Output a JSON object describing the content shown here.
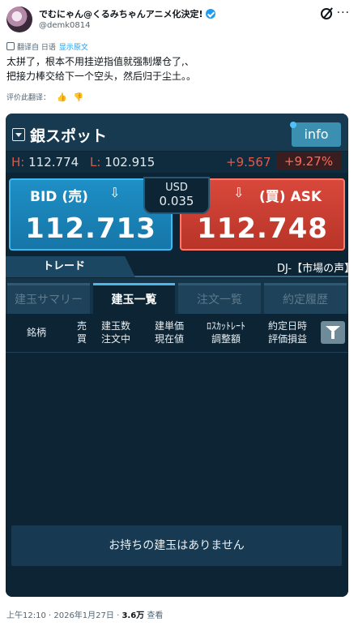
{
  "tweet": {
    "display_name": "でむにゃん@くるみちゃんアニメ化決定!",
    "handle": "@demk0814",
    "more": "···",
    "translation_label": "翻译自 日语",
    "show_original": "显示原文",
    "text_line1": "太拼了，根本不用挂逆指值就强制爆仓了,、",
    "text_line2": "把接力棒交给下一个空头，然后归于尘土。。",
    "rate_translation": "评价此翻译：",
    "time": "上午12:10 · 2026年1月27日 · ",
    "views": "3.6万",
    "views_label": " 查看"
  },
  "app": {
    "symbol": "銀スポット",
    "info_label": "info",
    "high_label": "H:",
    "high_value": "112.774",
    "low_label": "L:",
    "low_value": "102.915",
    "change": "+9.567",
    "change_pct": "+9.27%",
    "bid": {
      "label": "BID (売)",
      "arrow": "⇩",
      "price": "112.713"
    },
    "ask": {
      "label": "(買) ASK",
      "arrow": "⇩",
      "price": "112.748"
    },
    "spread": {
      "currency": "USD",
      "value": "0.035"
    },
    "trade_tab": "トレード",
    "ticker": "DJ-【市場の声】",
    "subtabs": [
      "建玉サマリー",
      "建玉一覧",
      "注文一覧",
      "約定履歴"
    ],
    "columns": {
      "c1": "銘柄",
      "c2a": "売",
      "c2b": "買",
      "c3a": "建玉数",
      "c3b": "注文中",
      "c4a": "建単価",
      "c4b": "現在値",
      "c5a": "ﾛｽｶｯﾄﾚｰﾄ",
      "c5b": "調整額",
      "c6a": "約定日時",
      "c6b": "評価損益"
    },
    "empty_message": "お持ちの建玉はありません"
  },
  "colors": {
    "app_bg": "#0c2433",
    "bid_blue": "#1e8fc5",
    "ask_red": "#d8483b",
    "accent_info": "#3b8fb0",
    "change_red": "#e5584a"
  }
}
